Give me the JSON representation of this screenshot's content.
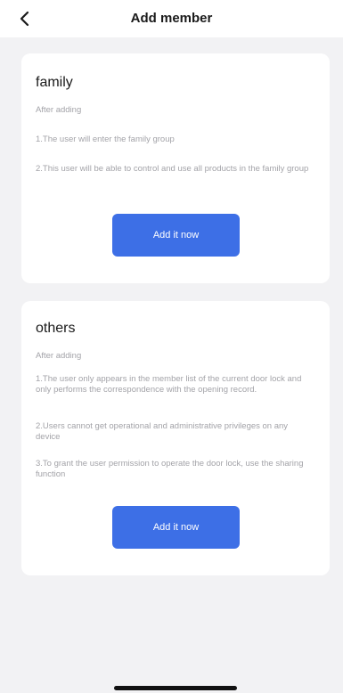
{
  "header": {
    "title": "Add member",
    "back_icon": "chevron-left-icon"
  },
  "family": {
    "title": "family",
    "subtitle": "After adding",
    "points": [
      "1.The user will enter the family group",
      "2.This user will be able to control and use all products in the family group"
    ],
    "button_label": "Add it now"
  },
  "others": {
    "title": "others",
    "subtitle": "After adding",
    "points": [
      "1.The user only appears in the member list of the current door lock and only performs the correspondence with the opening record.",
      "2.Users cannot get operational and administrative privileges on any device",
      "3.To grant the user permission to operate the door lock, use the sharing function"
    ],
    "button_label": "Add it now"
  },
  "colors": {
    "accent": "#3d6fe6",
    "background": "#f2f2f4",
    "card": "#ffffff",
    "muted_text": "#a3a3a8"
  }
}
